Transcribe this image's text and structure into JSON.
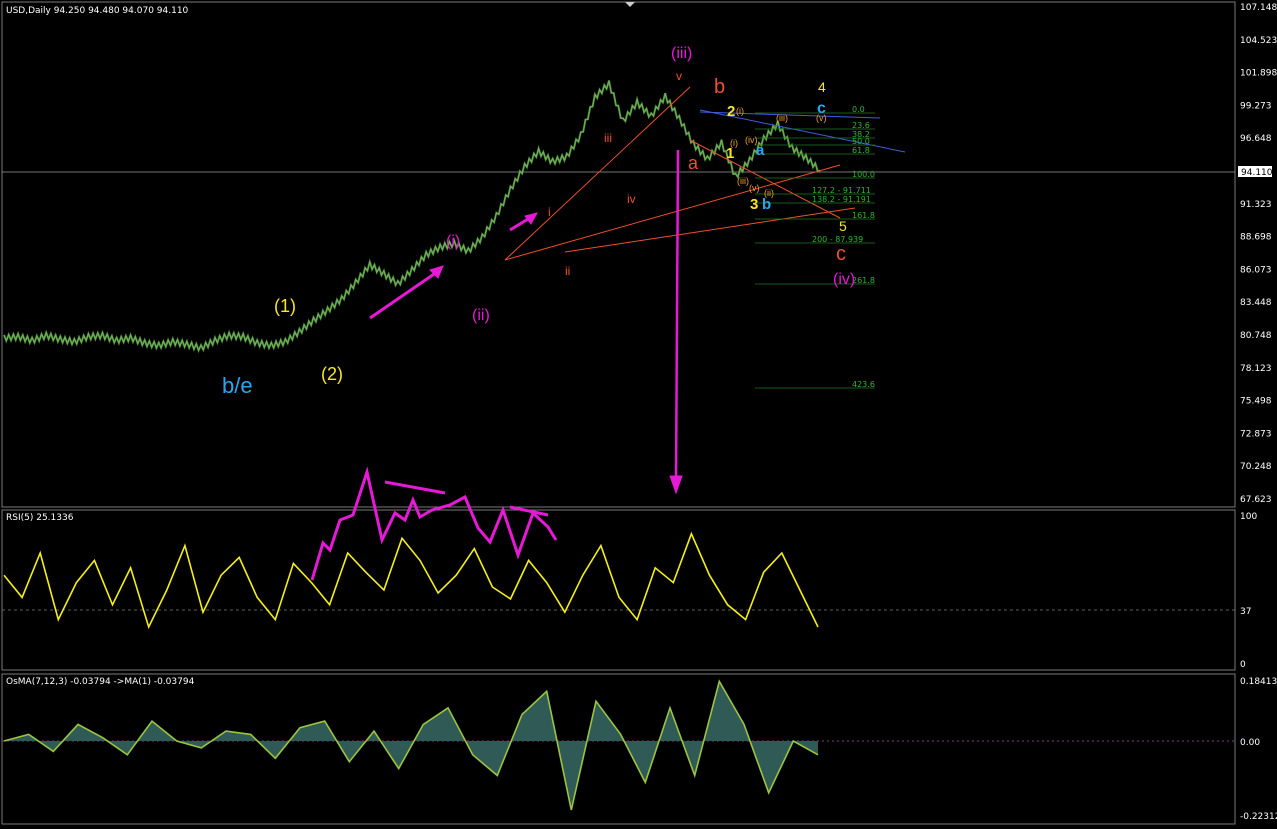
{
  "colors": {
    "background": "#000000",
    "price": "#4f8f3a",
    "rsi": "#f6f012",
    "osma": "#9bc53d",
    "osma_fill": "#2f5a55",
    "wave_magenta": "#e619d6",
    "trend_orange": "#f0502a",
    "trend_blue": "#3d5ee0",
    "fib_green": "#2db52d",
    "label_yellow": "#f6e52a",
    "label_cyan": "#2aa6f0",
    "label_red": "#f05030"
  },
  "main": {
    "header": "USD,Daily  94.250 94.480 94.070 94.110",
    "current_price": "94.110",
    "y_ticks": [
      "107.148",
      "104.523",
      "101.898",
      "99.273",
      "96.648",
      "94.110",
      "91.323",
      "88.698",
      "86.073",
      "83.448",
      "80.748",
      "78.123",
      "75.498",
      "72.873",
      "70.248",
      "67.623"
    ],
    "fib_levels": [
      "0.0",
      "23.6",
      "38.2",
      "50.0",
      "61.8",
      "100.0",
      "127.2 - 91.711",
      "138.2 - 91.191",
      "161.8",
      "200 - 87.939",
      "261.8",
      "423.6"
    ],
    "wave_labels": {
      "b_e": "b/e",
      "w1": "(1)",
      "w2": "(2)",
      "wi": "(i)",
      "wii": "(ii)",
      "wiii": "(iii)",
      "wiv": "(iv)",
      "r_i": "i",
      "r_ii": "ii",
      "r_iii": "iii",
      "r_iv": "iv",
      "r_v": "v",
      "a": "a",
      "b": "b",
      "c": "c",
      "y1": "1",
      "y2": "2",
      "y3": "3",
      "y4": "4",
      "y5": "5",
      "ca": "a",
      "cb": "b",
      "cc": "c",
      "s_i": "(i)",
      "s_ii": "(ii)",
      "s_iii": "(iii)",
      "s_iv": "(iv)",
      "s_v": "(v)",
      "s_i2": "(i)",
      "s_iii2": "(iii)",
      "s_v2": "(v)"
    }
  },
  "rsi": {
    "header": "RSI(5) 25.1336",
    "ticks": [
      "100",
      "37",
      "0"
    ]
  },
  "osma": {
    "header": "OsMA(7,12,3) -0.03794  ->MA(1) -0.03794",
    "ticks": [
      "0.18413",
      "0.00",
      "-0.22312"
    ]
  },
  "chart_data": [
    {
      "type": "line",
      "title": "USD,Daily",
      "series": [
        {
          "name": "USD",
          "values_description": "approx close path",
          "values": [
            80.8,
            80.9,
            80.6,
            81.0,
            80.7,
            80.5,
            80.9,
            81.0,
            80.6,
            80.8,
            80.4,
            80.2,
            80.5,
            80.3,
            80.0,
            80.6,
            81.0,
            80.9,
            80.4,
            80.2,
            80.5,
            81.3,
            82.2,
            83.0,
            83.9,
            85.2,
            86.6,
            85.9,
            85.1,
            86.2,
            87.4,
            88.0,
            88.3,
            87.7,
            88.8,
            90.5,
            92.6,
            94.4,
            95.6,
            94.8,
            95.2,
            96.9,
            99.9,
            101.0,
            98.0,
            99.5,
            98.4,
            100.0,
            98.2,
            96.2,
            95.0,
            96.3,
            93.6,
            94.9,
            96.6,
            97.8,
            95.9,
            95.1,
            94.1
          ]
        }
      ],
      "ylim": [
        67.623,
        107.148
      ]
    },
    {
      "type": "line",
      "title": "RSI(5)",
      "series": [
        {
          "name": "RSI(5)",
          "values": [
            60,
            45,
            75,
            30,
            55,
            70,
            40,
            65,
            25,
            50,
            80,
            35,
            60,
            72,
            45,
            30,
            68,
            55,
            40,
            75,
            62,
            50,
            85,
            70,
            48,
            60,
            78,
            52,
            44,
            70,
            55,
            35,
            60,
            80,
            45,
            30,
            65,
            55,
            88,
            60,
            40,
            30,
            62,
            75,
            50,
            25
          ]
        }
      ],
      "ylim": [
        0,
        100
      ]
    },
    {
      "type": "line",
      "title": "OsMA(7,12,3)",
      "series": [
        {
          "name": "OsMA",
          "values": [
            0.0,
            0.02,
            -0.03,
            0.05,
            0.01,
            -0.04,
            0.06,
            0.0,
            -0.02,
            0.03,
            0.02,
            -0.05,
            0.04,
            0.06,
            -0.06,
            0.03,
            -0.08,
            0.05,
            0.1,
            -0.04,
            -0.1,
            0.08,
            0.15,
            -0.2,
            0.12,
            0.02,
            -0.12,
            0.1,
            -0.1,
            0.18,
            0.05,
            -0.15,
            0.0,
            -0.04
          ]
        }
      ],
      "ylim": [
        -0.22312,
        0.18413
      ]
    }
  ]
}
